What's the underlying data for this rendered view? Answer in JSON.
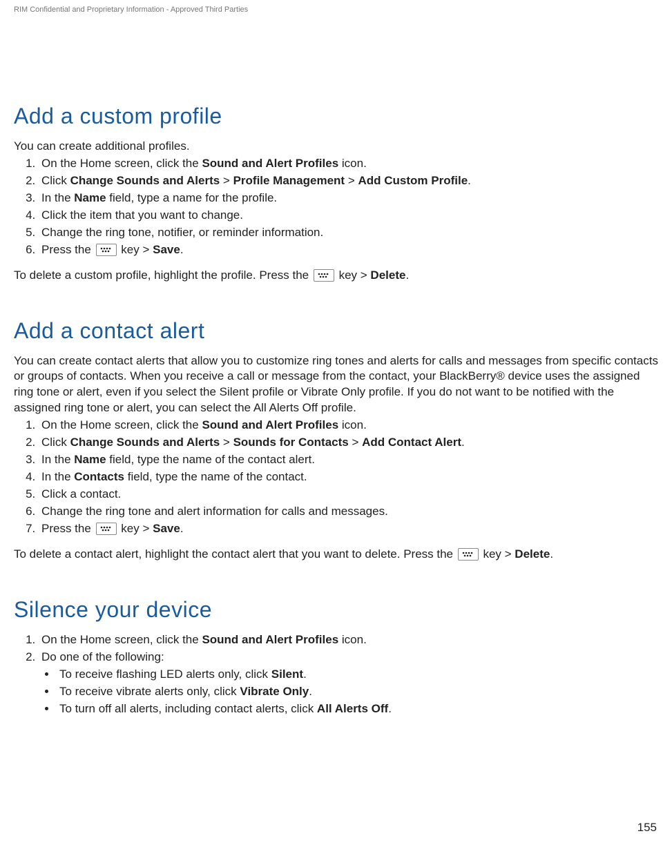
{
  "header": {
    "confidential": "RIM Confidential and Proprietary Information - Approved Third Parties"
  },
  "page_number": "155",
  "sections": {
    "custom_profile": {
      "title": "Add a custom profile",
      "intro": "You can create additional profiles.",
      "steps": {
        "s1_pre": "On the Home screen, click the ",
        "s1_bold": "Sound and Alert Profiles",
        "s1_post": " icon.",
        "s2_pre": "Click ",
        "s2_b1": "Change Sounds and Alerts",
        "s2_gt1": " > ",
        "s2_b2": "Profile Management",
        "s2_gt2": " > ",
        "s2_b3": "Add Custom Profile",
        "s2_post": ".",
        "s3_pre": "In the ",
        "s3_bold": "Name",
        "s3_post": " field, type a name for the profile.",
        "s4": "Click the item that you want to change.",
        "s5": "Change the ring tone, notifier, or reminder information.",
        "s6_pre": "Press the ",
        "s6_mid": " key > ",
        "s6_bold": "Save",
        "s6_post": "."
      },
      "after": {
        "pre": "To delete a custom profile, highlight the profile. Press the ",
        "mid": " key > ",
        "bold": "Delete",
        "post": "."
      }
    },
    "contact_alert": {
      "title": "Add a contact alert",
      "intro": "You can create contact alerts that allow you to customize ring tones and alerts for calls and messages from specific contacts or groups of contacts. When you receive a call or message from the contact, your BlackBerry® device uses the assigned ring tone or alert, even if you select the Silent profile or Vibrate Only profile. If you do not want to be notified with the assigned ring tone or alert, you can select the All Alerts Off profile.",
      "steps": {
        "s1_pre": "On the Home screen, click the ",
        "s1_bold": "Sound and Alert Profiles",
        "s1_post": " icon.",
        "s2_pre": "Click ",
        "s2_b1": "Change Sounds and Alerts",
        "s2_gt1": " > ",
        "s2_b2": "Sounds for Contacts",
        "s2_gt2": " > ",
        "s2_b3": "Add Contact Alert",
        "s2_post": ".",
        "s3_pre": "In the ",
        "s3_bold": "Name",
        "s3_post": " field, type the name of the contact alert.",
        "s4_pre": "In the ",
        "s4_bold": "Contacts",
        "s4_post": " field, type the name of the contact.",
        "s5": "Click a contact.",
        "s6": "Change the ring tone and alert information for calls and messages.",
        "s7_pre": "Press the ",
        "s7_mid": " key > ",
        "s7_bold": "Save",
        "s7_post": "."
      },
      "after": {
        "pre": "To delete a contact alert, highlight the contact alert that you want to delete. Press the ",
        "mid": " key > ",
        "bold": "Delete",
        "post": "."
      }
    },
    "silence": {
      "title": "Silence your device",
      "steps": {
        "s1_pre": "On the Home screen, click the ",
        "s1_bold": "Sound and Alert Profiles",
        "s1_post": " icon.",
        "s2": "Do one of the following:",
        "b1_pre": "To receive flashing LED alerts only, click ",
        "b1_bold": "Silent",
        "b1_post": ".",
        "b2_pre": "To receive vibrate alerts only, click ",
        "b2_bold": "Vibrate Only",
        "b2_post": ".",
        "b3_pre": "To turn off all alerts, including contact alerts, click ",
        "b3_bold": "All Alerts Off",
        "b3_post": "."
      }
    }
  }
}
